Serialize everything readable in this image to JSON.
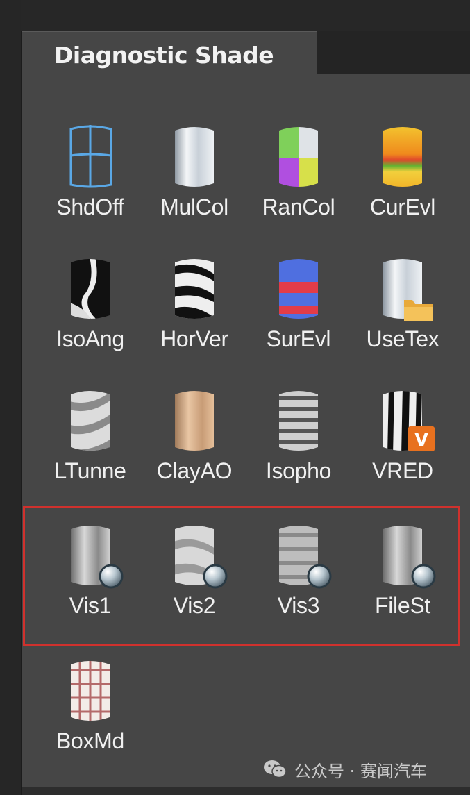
{
  "panel": {
    "title": "Diagnostic Shade"
  },
  "tools": [
    {
      "label": "ShdOff",
      "icon": "shade-off-icon"
    },
    {
      "label": "MulCol",
      "icon": "multi-color-icon"
    },
    {
      "label": "RanCol",
      "icon": "random-color-icon"
    },
    {
      "label": "CurEvl",
      "icon": "curvature-evaluation-icon"
    },
    {
      "label": "IsoAng",
      "icon": "isoangle-icon"
    },
    {
      "label": "HorVer",
      "icon": "horizontal-vertical-icon"
    },
    {
      "label": "SurEvl",
      "icon": "surface-evaluation-icon"
    },
    {
      "label": "UseTex",
      "icon": "use-texture-icon"
    },
    {
      "label": "LTunne",
      "icon": "light-tunnel-icon"
    },
    {
      "label": "ClayAO",
      "icon": "clay-ao-icon"
    },
    {
      "label": "Isopho",
      "icon": "isophote-icon"
    },
    {
      "label": "VRED",
      "icon": "vred-icon"
    },
    {
      "label": "Vis1",
      "icon": "visual-1-icon"
    },
    {
      "label": "Vis2",
      "icon": "visual-2-icon"
    },
    {
      "label": "Vis3",
      "icon": "visual-3-icon"
    },
    {
      "label": "FileSt",
      "icon": "file-shader-icon"
    },
    {
      "label": "BoxMd",
      "icon": "box-mode-icon"
    }
  ],
  "watermark": {
    "text": "公众号 · 赛闻汽车",
    "icon": "wechat-icon"
  },
  "colors": {
    "highlight": "#d0312d",
    "panel": "#464646",
    "tab_bg": "#242424"
  }
}
